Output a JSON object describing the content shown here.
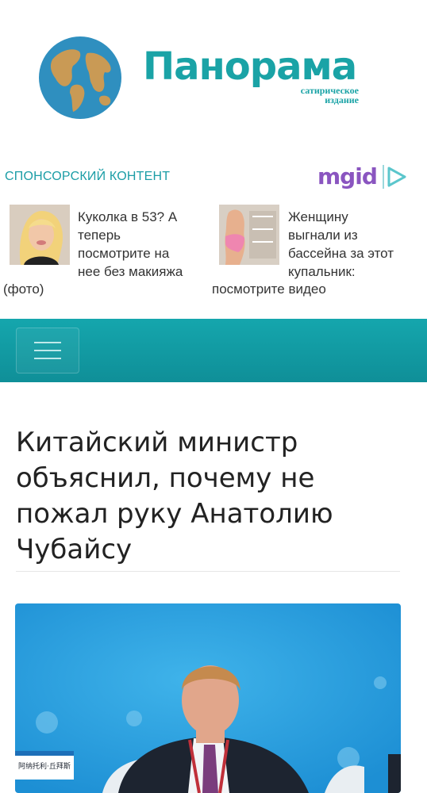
{
  "header": {
    "logo_title": "Панорама",
    "logo_subtitle_1": "сатирическое",
    "logo_subtitle_2": "издание"
  },
  "sponsor": {
    "label": "СПОНСОРСКИЙ КОНТЕНТ",
    "network": "mgid",
    "items": [
      {
        "lines": [
          "Куколка в 53? А",
          "теперь",
          "посмотрите на",
          "нее без макияжа"
        ],
        "tail": "(фото)"
      },
      {
        "lines": [
          "Женщину",
          "выгнали из",
          "бассейна за этот",
          "купальник:"
        ],
        "tail": "посмотрите видео"
      }
    ]
  },
  "nav": {
    "menu_icon": "hamburger-icon"
  },
  "article": {
    "title": "Китайский министр объяснил, почему не пожал руку Анатолию Чубайсу",
    "photo_caption_text": "阿纳托利·丘拜斯"
  },
  "colors": {
    "brand": "#1aa3a6",
    "navbar": "#15a6ad",
    "mgid": "#8a55c0",
    "photo_bg": "#2aa3e0"
  }
}
